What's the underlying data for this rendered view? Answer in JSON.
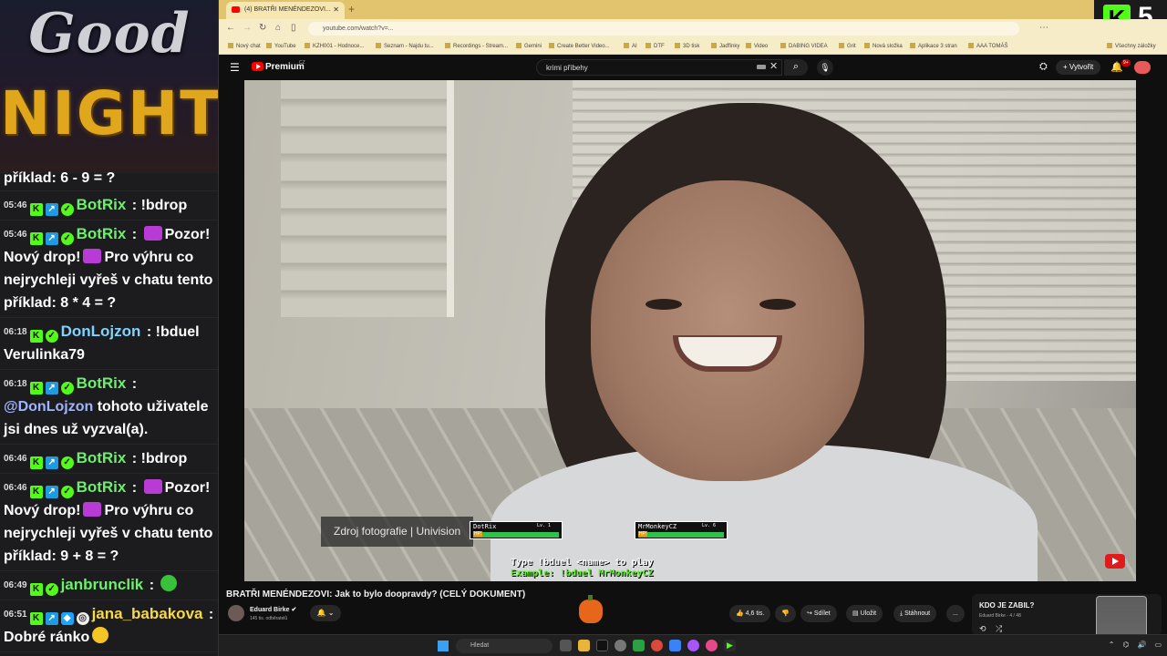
{
  "overlay": {
    "good": "Good",
    "night": "NIGHT"
  },
  "chat": {
    "top_fragment": "příklad: 6 - 9 = ?",
    "messages": [
      {
        "time": "05:46",
        "user": "BotRix",
        "sep": " : ",
        "text": "!bdrop"
      },
      {
        "time": "05:46",
        "user": "BotRix",
        "sep": " : ",
        "text_a": "Pozor! Nový drop!",
        "text_b": "Pro výhru co nejrychleji vyřeš v chatu tento příklad: 8 * 4 = ?"
      },
      {
        "time": "06:18",
        "user": "DonLojzon",
        "sep": " : ",
        "text": "!bduel Verulinka79"
      },
      {
        "time": "06:18",
        "user": "BotRix",
        "sep": " : ",
        "mention": "@DonLojzon",
        "text": " tohoto uživatele jsi dnes už vyzval(a)."
      },
      {
        "time": "06:46",
        "user": "BotRix",
        "sep": " : ",
        "text": "!bdrop"
      },
      {
        "time": "06:46",
        "user": "BotRix",
        "sep": " : ",
        "text_a": "Pozor! Nový drop!",
        "text_b": "Pro výhru co nejrychleji vyřeš v chatu tento příklad: 9 + 8 = ?"
      },
      {
        "time": "06:49",
        "user": "janbrunclik",
        "sep": " : ",
        "text": ""
      },
      {
        "time": "06:51",
        "user": "jana_babakova",
        "sep": " : ",
        "text": "Dobré ránko"
      }
    ]
  },
  "browser": {
    "tab_title": "(4) BRATŘI MENÉNDEZOVI...",
    "url": "youtube.com/watch?v=...",
    "k_badge": "K",
    "k_count": "5",
    "bookmarks": [
      "Nový chat",
      "YouTube",
      "KZH001 - Hodnoce...",
      "Seznam - Najdu tu...",
      "Recordings - Stream...",
      "Gemini",
      "Create Better Video...",
      "AI",
      "DTF",
      "3D tisk",
      "Jaďfinky",
      "Video",
      "DABING VIDEA",
      "Grit",
      "Nová složka",
      "Aplikace 3 stran",
      "AAA TOMÁŠ",
      "Všechny záložky"
    ]
  },
  "youtube": {
    "brand": "Premium",
    "brand_sup": "CZ",
    "search_value": "krimi příbehy",
    "create_label": "Vytvořit",
    "notif_count": "9+",
    "video": {
      "source_caption": "Zdroj fotografie | Univision",
      "duel_p1": "DotRix",
      "duel_p1_level": "Lv. 1",
      "duel_p2": "MrMonkeyCZ",
      "duel_p2_level": "Lv. 6",
      "duel_instruction": "Type !bduel <name> to play",
      "duel_example": "Example: !bduel MrMonkeyCZ"
    },
    "title": "BRATŘI MENÉNDEZOVI: Jak to bylo doopravdy? (CELÝ DOKUMENT)",
    "channel": "Eduard Birke",
    "subscribers": "145 tis. odběratelů",
    "likes": "4,6 tis.",
    "share_label": "Sdílet",
    "save_label": "Uložit",
    "download_label": "Stáhnout",
    "more_label": "...",
    "playlist_title": "KDO JE ZABIL?",
    "playlist_meta": "Eduard Birke - 4 / 48"
  },
  "taskbar": {
    "search_placeholder": "Hledat"
  }
}
